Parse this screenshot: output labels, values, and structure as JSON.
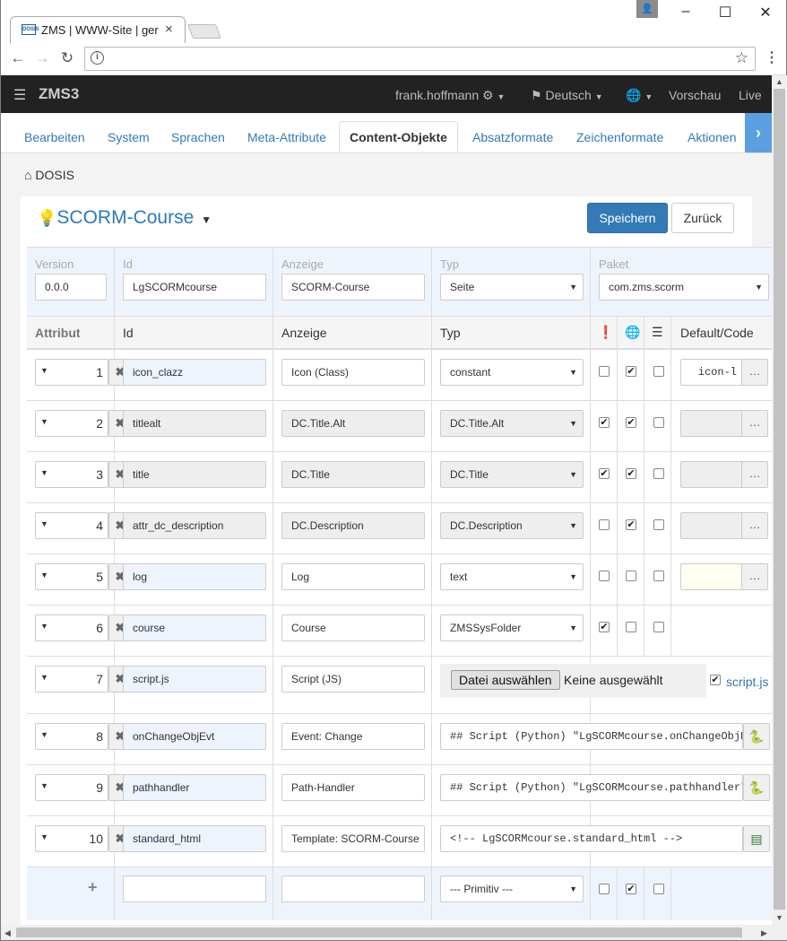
{
  "browser": {
    "tab_title": "ZMS | WWW-Site | ger",
    "favicon_text": "DOSIS",
    "url": ""
  },
  "app": {
    "brand": "ZMS3",
    "user": "frank.hoffmann",
    "language": "Deutsch",
    "preview": "Vorschau",
    "live": "Live"
  },
  "tabs": [
    "Bearbeiten",
    "System",
    "Sprachen",
    "Meta-Attribute",
    "Content-Objekte",
    "Absatzformate",
    "Zeichenformate",
    "Aktionen"
  ],
  "active_tab": "Content-Objekte",
  "breadcrumb": "DOSIS",
  "object": {
    "title": "SCORM-Course",
    "save_label": "Speichern",
    "back_label": "Zurück"
  },
  "meta": {
    "version_label": "Version",
    "version": "0.0.0",
    "id_label": "Id",
    "id": "LgSCORMcourse",
    "display_label": "Anzeige",
    "display": "SCORM-Course",
    "type_label": "Typ",
    "type": "Seite",
    "package_label": "Paket",
    "package": "com.zms.scorm"
  },
  "columns": {
    "attribute": "Attribut",
    "id": "Id",
    "display": "Anzeige",
    "type": "Typ",
    "default": "Default/Code"
  },
  "rows": [
    {
      "n": "1",
      "id": "icon_clazz",
      "display": "Icon (Class)",
      "type": "constant",
      "mandatory": false,
      "multilang": true,
      "repetitive": false,
      "default": "icon-l"
    },
    {
      "n": "2",
      "id": "titlealt",
      "display": "DC.Title.Alt",
      "type": "DC.Title.Alt",
      "mandatory": true,
      "multilang": true,
      "repetitive": false,
      "default": ""
    },
    {
      "n": "3",
      "id": "title",
      "display": "DC.Title",
      "type": "DC.Title",
      "mandatory": true,
      "multilang": true,
      "repetitive": false,
      "default": ""
    },
    {
      "n": "4",
      "id": "attr_dc_description",
      "display": "DC.Description",
      "type": "DC.Description",
      "mandatory": false,
      "multilang": true,
      "repetitive": false,
      "default": ""
    },
    {
      "n": "5",
      "id": "log",
      "display": "Log",
      "type": "text",
      "mandatory": false,
      "multilang": false,
      "repetitive": false,
      "default": ""
    },
    {
      "n": "6",
      "id": "course",
      "display": "Course",
      "type": "ZMSSysFolder",
      "mandatory": true,
      "multilang": false,
      "repetitive": false,
      "default": ""
    },
    {
      "n": "7",
      "id": "script.js",
      "display": "Script (JS)",
      "file_button": "Datei auswählen",
      "file_status": "Keine ausgewählt",
      "file_link": "script.js"
    },
    {
      "n": "8",
      "id": "onChangeObjEvt",
      "display": "Event: Change",
      "code": "## Script (Python) \"LgSCORMcourse.onChangeObjEvt\""
    },
    {
      "n": "9",
      "id": "pathhandler",
      "display": "Path-Handler",
      "code": "## Script (Python) \"LgSCORMcourse.pathhandler\""
    },
    {
      "n": "10",
      "id": "standard_html",
      "display": "Template: SCORM-Course",
      "code": "<!-- LgSCORMcourse.standard_html -->"
    }
  ],
  "new_row": {
    "add": "+",
    "type": "--- Primitiv ---"
  }
}
